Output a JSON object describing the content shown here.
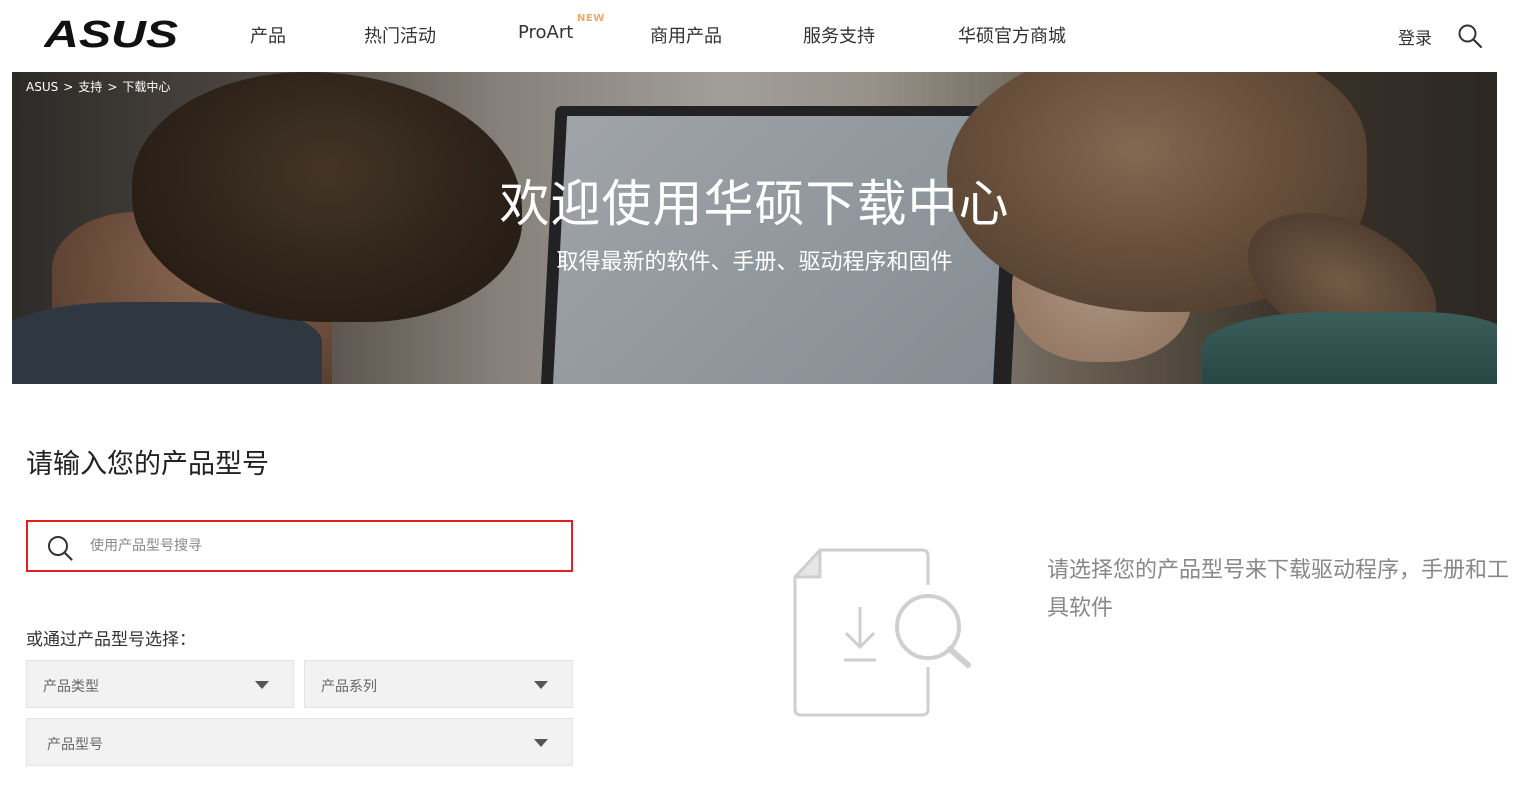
{
  "header": {
    "logo_text": "ASUS",
    "nav": [
      {
        "label": "产品"
      },
      {
        "label": "热门活动"
      },
      {
        "label": "ProArt",
        "badge": "NEW"
      },
      {
        "label": "商用产品"
      },
      {
        "label": "服务支持"
      },
      {
        "label": "华硕官方商城"
      }
    ],
    "login_label": "登录",
    "search_icon": "search-icon"
  },
  "hero": {
    "breadcrumb": [
      "ASUS",
      "支持",
      "下载中心"
    ],
    "breadcrumb_sep": ">",
    "title": "欢迎使用华硕下载中心",
    "subtitle": "取得最新的软件、手册、驱动程序和固件"
  },
  "main": {
    "section_title": "请输入您的产品型号",
    "search": {
      "placeholder": "使用产品型号搜寻",
      "value": ""
    },
    "or_label": "或通过产品型号选择：",
    "selects": {
      "type": "产品类型",
      "series": "产品系列",
      "model": "产品型号"
    },
    "hint": "请选择您的产品型号来下载驱动程序，手册和工具软件"
  },
  "colors": {
    "accent_red": "#e02020",
    "new_badge": "#f0a96b",
    "hint_gray": "#888888"
  }
}
